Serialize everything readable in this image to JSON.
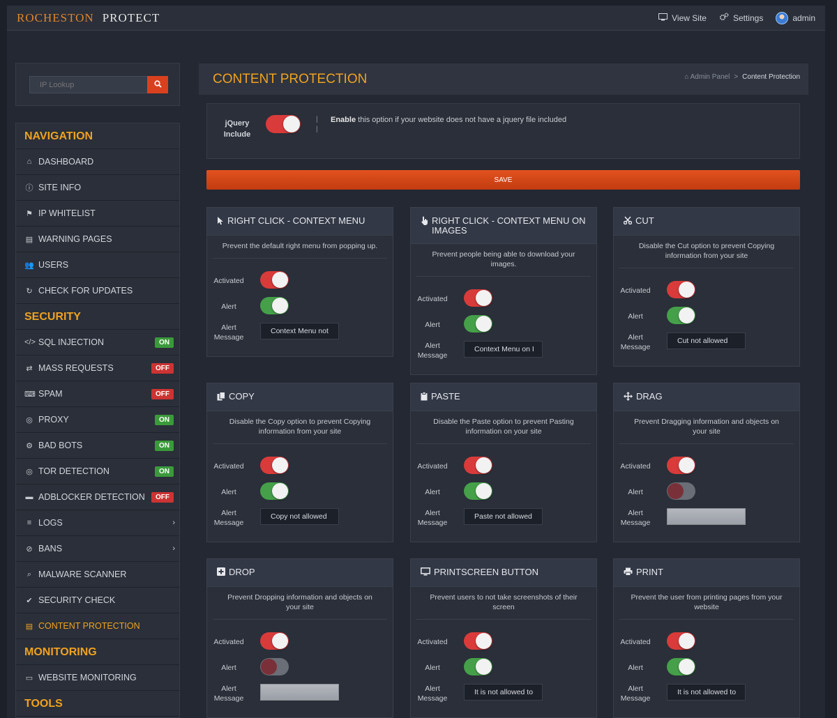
{
  "brand": {
    "name_a": "ROCHESTON",
    "name_b": "PROTECT"
  },
  "topnav": {
    "view_site": "View Site",
    "settings": "Settings",
    "user": "admin"
  },
  "ip_lookup": {
    "placeholder": "IP Lookup"
  },
  "sidebar": {
    "navigation": "NAVIGATION",
    "nav_items": [
      "DASHBOARD",
      "SITE INFO",
      "IP WHITELIST",
      "WARNING PAGES",
      "USERS",
      "CHECK FOR UPDATES"
    ],
    "security": "SECURITY",
    "security_items": [
      {
        "label": "SQL INJECTION",
        "status": "ON"
      },
      {
        "label": "MASS REQUESTS",
        "status": "OFF"
      },
      {
        "label": "SPAM",
        "status": "OFF"
      },
      {
        "label": "PROXY",
        "status": "ON"
      },
      {
        "label": "BAD BOTS",
        "status": "ON"
      },
      {
        "label": "TOR DETECTION",
        "status": "ON"
      },
      {
        "label": "ADBLOCKER DETECTION",
        "status": "OFF"
      },
      {
        "label": "LOGS",
        "chevron": "›"
      },
      {
        "label": "BANS",
        "chevron": "›"
      },
      {
        "label": "MALWARE SCANNER"
      },
      {
        "label": "SECURITY CHECK"
      },
      {
        "label": "CONTENT PROTECTION"
      }
    ],
    "monitoring": "MONITORING",
    "monitoring_items": [
      "WEBSITE MONITORING"
    ],
    "tools": "TOOLS"
  },
  "page": {
    "title": "CONTENT PROTECTION",
    "breadcrumb_home": "Admin Panel",
    "breadcrumb_sep": ">",
    "breadcrumb_current": "Content Protection"
  },
  "jquery": {
    "label": "jQuery Include",
    "desc_bold": "Enable",
    "desc_rest": " this option if your website does not have a jquery file included",
    "sep": "|"
  },
  "save_label": "SAVE",
  "labels": {
    "activated": "Activated",
    "alert": "Alert",
    "alert_msg_1": "Alert",
    "alert_msg_2": "Message"
  },
  "cards": [
    {
      "title": "RIGHT CLICK - CONTEXT MENU",
      "desc": "Prevent the default right menu from popping up.",
      "message": "Context Menu not"
    },
    {
      "title": "RIGHT CLICK - CONTEXT MENU ON IMAGES",
      "desc": "Prevent people being able to download your images.",
      "message": "Context Menu on I"
    },
    {
      "title": "CUT",
      "desc": "Disable the Cut option to prevent Copying information from your site",
      "message": "Cut not allowed"
    },
    {
      "title": "COPY",
      "desc": "Disable the Copy option to prevent Copying information from your site",
      "message": "Copy not allowed"
    },
    {
      "title": "PASTE",
      "desc": "Disable the Paste option to prevent Pasting information on your site",
      "message": "Paste not allowed"
    },
    {
      "title": "DRAG",
      "desc": "Prevent Dragging information and objects on your site",
      "message": ""
    },
    {
      "title": "DROP",
      "desc": "Prevent Dropping information and objects on your site",
      "message": ""
    },
    {
      "title": "PRINTSCREEN BUTTON",
      "desc": "Prevent users to not take screenshots of their screen",
      "message": "It is not allowed to"
    },
    {
      "title": "PRINT",
      "desc": "Prevent the user from printing pages from your website",
      "message": "It is not allowed to"
    }
  ],
  "colors": {
    "accent": "#f0a21e",
    "save": "#d9411e",
    "on": "#3a9a3a",
    "off": "#cc3333",
    "toggle_red": "#d93b3b",
    "toggle_green": "#45a049"
  }
}
